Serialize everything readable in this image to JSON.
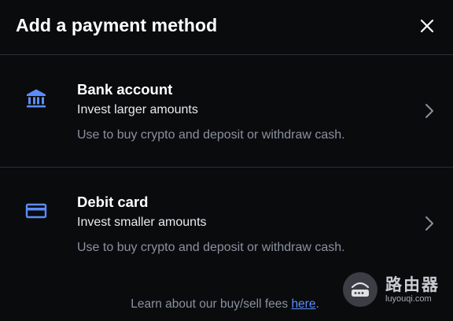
{
  "header": {
    "title": "Add a payment method",
    "close_icon": "close-icon"
  },
  "options": [
    {
      "name": "Bank account",
      "subtitle": "Invest larger amounts",
      "description": "Use to buy crypto and deposit or withdraw cash.",
      "icon": "bank-icon"
    },
    {
      "name": "Debit card",
      "subtitle": "Invest smaller amounts",
      "description": "Use to buy crypto and deposit or withdraw cash.",
      "icon": "card-icon"
    }
  ],
  "footer": {
    "text": "Learn about our buy/sell fees ",
    "link": "here",
    "end": "."
  },
  "watermark": {
    "title": "路由器",
    "sub": "luyouqi.com"
  },
  "colors": {
    "background": "#0a0b0d",
    "accent": "#5b8cff",
    "muted": "#8a919e",
    "divider": "#2b2e33"
  }
}
